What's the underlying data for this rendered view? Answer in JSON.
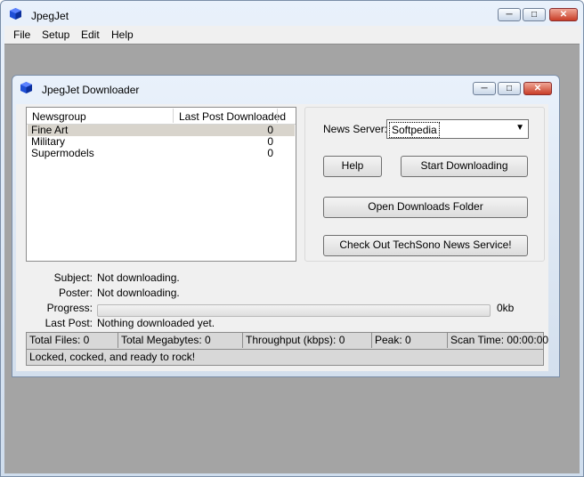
{
  "window": {
    "title": "JpegJet",
    "controls": {
      "minimize": "─",
      "maximize": "□",
      "close": "✕"
    }
  },
  "menu": [
    "File",
    "Setup",
    "Edit",
    "Help"
  ],
  "child": {
    "title": "JpegJet Downloader",
    "controls": {
      "minimize": "─",
      "maximize": "□",
      "close": "✕"
    }
  },
  "list": {
    "columns": [
      "Newsgroup",
      "Last Post Downloaded"
    ],
    "rows": [
      {
        "name": "Fine Art",
        "count": "0",
        "selected": true
      },
      {
        "name": "Military",
        "count": "0",
        "selected": false
      },
      {
        "name": "Supermodels",
        "count": "0",
        "selected": false
      }
    ]
  },
  "server": {
    "label": "News Server:",
    "value": "Softpedia"
  },
  "buttons": {
    "help": "Help",
    "start": "Start Downloading",
    "open_folder": "Open Downloads Folder",
    "techsono": "Check Out TechSono News Service!"
  },
  "info": {
    "subject_label": "Subject:",
    "subject_value": "Not downloading.",
    "poster_label": "Poster:",
    "poster_value": "Not downloading.",
    "progress_label": "Progress:",
    "progress_fraction": 0,
    "progress_text": "0kb",
    "lastpost_label": "Last Post:",
    "lastpost_value": "Nothing downloaded yet."
  },
  "status": {
    "total_files": "Total Files:  0",
    "total_mb": "Total Megabytes:  0",
    "throughput": "Throughput (kbps): 0",
    "peak": "Peak: 0",
    "scan_time": "Scan Time: 00:00:00",
    "message": "Locked, cocked, and ready to rock!"
  },
  "colors": {
    "accent": "#1f4fd6",
    "close": "#c83d27",
    "progress": "#39c63a"
  }
}
